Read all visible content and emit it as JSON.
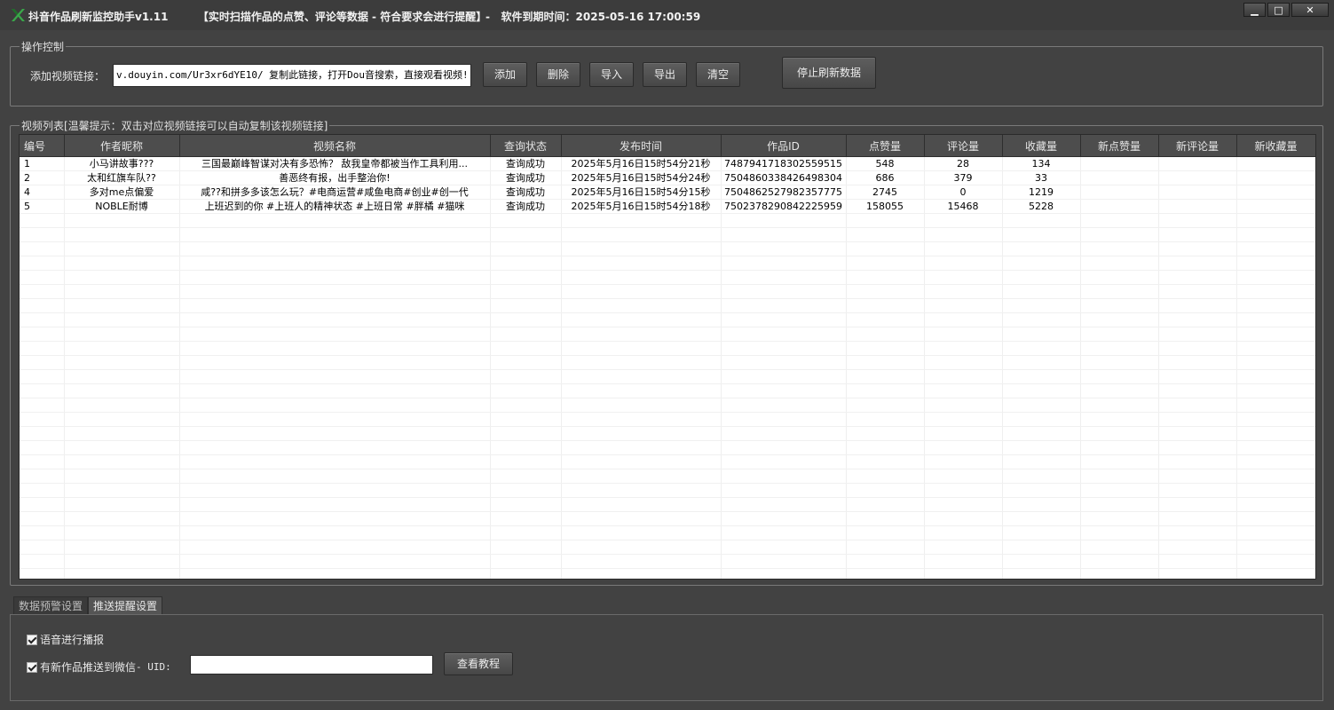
{
  "window": {
    "title": "抖音作品刷新监控助手v1.11",
    "subtitle": "【实时扫描作品的点赞、评论等数据 - 符合要求会进行提醒】",
    "separator": "-",
    "expiry": "软件到期时间：2025-05-16 17:00:59",
    "minimize_symbol": "▁",
    "maximize_symbol": "□",
    "close_symbol": "✕"
  },
  "control_group": {
    "legend": "操作控制",
    "url_label": "添加视频链接：",
    "url_value": "v.douyin.com/Ur3xr6dYE10/ 复制此链接，打开Dou音搜索，直接观看视频!",
    "buttons": {
      "add": "添加",
      "delete": "删除",
      "import": "导入",
      "export": "导出",
      "clear": "清空"
    },
    "stop_refresh": "停止刷新数据"
  },
  "list_group": {
    "legend": "视频列表[温馨提示：双击对应视频链接可以自动复制该视频链接]",
    "columns": [
      "编号",
      "作者昵称",
      "视频名称",
      "查询状态",
      "发布时间",
      "作品ID",
      "点赞量",
      "评论量",
      "收藏量",
      "新点赞量",
      "新评论量",
      "新收藏量"
    ],
    "rows": [
      [
        "1",
        "小马讲故事???",
        "三国最巅峰智谋对决有多恐怖？ 敌我皇帝都被当作工具利用...",
        "查询成功",
        "2025年5月16日15时54分21秒",
        "7487941718302559515",
        "548",
        "28",
        "134",
        "",
        "",
        ""
      ],
      [
        "2",
        "太和红旗车队??",
        "善恶终有报，出手整治你!",
        "查询成功",
        "2025年5月16日15时54分24秒",
        "7504860338426498304",
        "686",
        "379",
        "33",
        "",
        "",
        ""
      ],
      [
        "4",
        "多对me点偏爱",
        "咸??和拼多多该怎么玩？#电商运营#咸鱼电商#创业#创一代",
        "查询成功",
        "2025年5月16日15时54分15秒",
        "7504862527982357775",
        "2745",
        "0",
        "1219",
        "",
        "",
        ""
      ],
      [
        "5",
        "NOBLE耐博",
        "上班迟到的你 #上班人的精神状态 #上班日常 #胖橘 #猫咪",
        "查询成功",
        "2025年5月16日15时54分18秒",
        "7502378290842225959",
        "158055",
        "15468",
        "5228",
        "",
        "",
        ""
      ]
    ]
  },
  "settings": {
    "tabs": [
      "数据预警设置",
      "推送提醒设置"
    ],
    "active_tab": "推送提醒设置",
    "voice_label": "语音进行播报",
    "wechat_label": "有新作品推送到微信",
    "uid_label": " - UID:",
    "uid_value": "",
    "tutorial_button": "查看教程"
  },
  "colors": {
    "background": "#424242",
    "header": "#4d4d4d",
    "table_bg": "#ffffff",
    "icon_green": "#2e7d32"
  }
}
